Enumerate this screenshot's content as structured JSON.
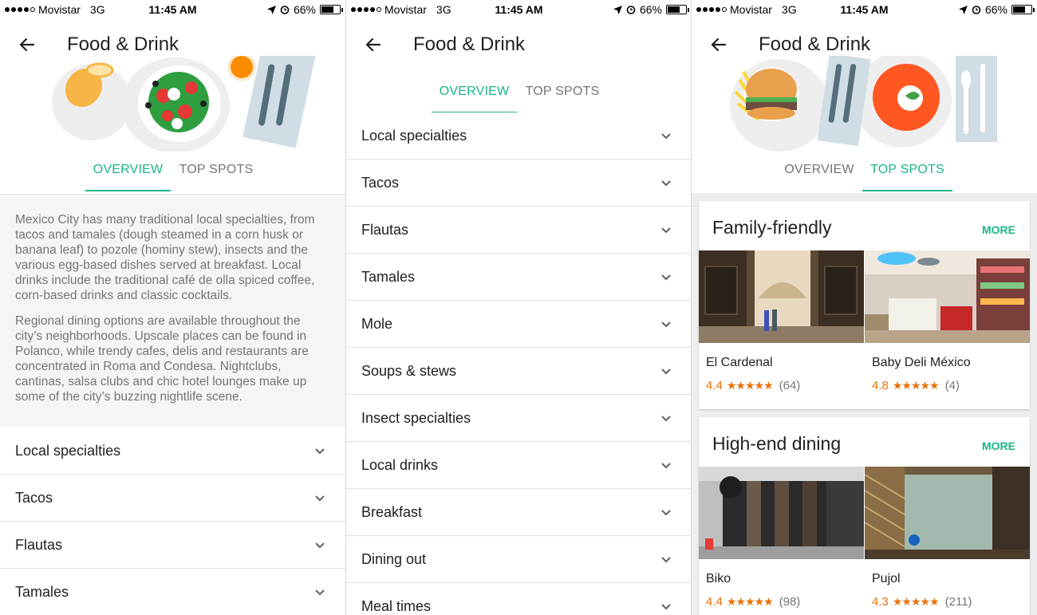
{
  "status_bar": {
    "carrier": "Movistar",
    "network": "3G",
    "time": "11:45 AM",
    "battery": "66%"
  },
  "header": {
    "title": "Food & Drink"
  },
  "tabs": {
    "overview": "OVERVIEW",
    "top_spots": "TOP SPOTS"
  },
  "overview": {
    "paragraph_1": "Mexico City has many traditional local specialties, from tacos and tamales (dough steamed in a corn husk or banana leaf) to pozole (hominy stew), insects and the various egg-based dishes served at breakfast. Local drinks include the traditional café de olla spiced coffee, corn-based drinks and classic cocktails.",
    "paragraph_2": "Regional dining options are available throughout the city’s neighborhoods. Upscale places can be found in Polanco, while trendy cafes, delis and restaurants are concentrated in Roma and Condesa. Nightclubs, cantinas, salsa clubs and chic hotel lounges make up some of the city’s buzzing nightlife scene."
  },
  "categories": [
    "Local specialties",
    "Tacos",
    "Flautas",
    "Tamales",
    "Mole",
    "Soups & stews",
    "Insect specialties",
    "Local drinks",
    "Breakfast",
    "Dining out",
    "Meal times"
  ],
  "top_spots": {
    "more_label": "MORE",
    "groups": [
      {
        "title": "Family-friendly",
        "places": [
          {
            "name": "El Cardenal",
            "rating": "4.4",
            "stars": "★★★★★",
            "reviews": "(64)"
          },
          {
            "name": "Baby Deli México",
            "rating": "4.8",
            "stars": "★★★★★",
            "reviews": "(4)"
          }
        ]
      },
      {
        "title": "High-end dining",
        "places": [
          {
            "name": "Biko",
            "rating": "4.4",
            "stars": "★★★★★",
            "reviews": "(98)"
          },
          {
            "name": "Pujol",
            "rating": "4.3",
            "stars": "★★★★★",
            "reviews": "(211)"
          }
        ]
      }
    ]
  },
  "colors": {
    "accent": "#1bb58a",
    "rating": "#e8710a",
    "muted_text": "#757575"
  }
}
